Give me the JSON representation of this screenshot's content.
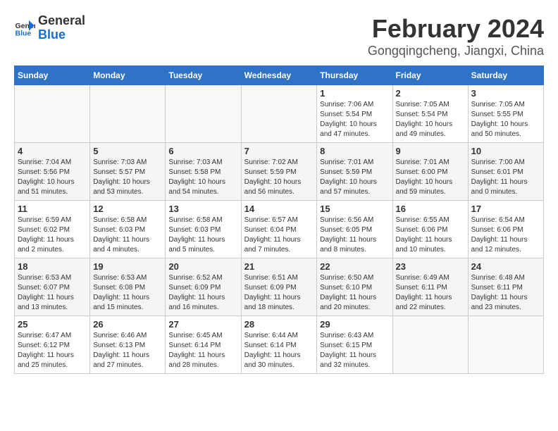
{
  "header": {
    "logo_general": "General",
    "logo_blue": "Blue",
    "title": "February 2024",
    "subtitle": "Gongqingcheng, Jiangxi, China"
  },
  "days_of_week": [
    "Sunday",
    "Monday",
    "Tuesday",
    "Wednesday",
    "Thursday",
    "Friday",
    "Saturday"
  ],
  "weeks": [
    [
      {
        "day": "",
        "info": ""
      },
      {
        "day": "",
        "info": ""
      },
      {
        "day": "",
        "info": ""
      },
      {
        "day": "",
        "info": ""
      },
      {
        "day": "1",
        "info": "Sunrise: 7:06 AM\nSunset: 5:54 PM\nDaylight: 10 hours and 47 minutes."
      },
      {
        "day": "2",
        "info": "Sunrise: 7:05 AM\nSunset: 5:54 PM\nDaylight: 10 hours and 49 minutes."
      },
      {
        "day": "3",
        "info": "Sunrise: 7:05 AM\nSunset: 5:55 PM\nDaylight: 10 hours and 50 minutes."
      }
    ],
    [
      {
        "day": "4",
        "info": "Sunrise: 7:04 AM\nSunset: 5:56 PM\nDaylight: 10 hours and 51 minutes."
      },
      {
        "day": "5",
        "info": "Sunrise: 7:03 AM\nSunset: 5:57 PM\nDaylight: 10 hours and 53 minutes."
      },
      {
        "day": "6",
        "info": "Sunrise: 7:03 AM\nSunset: 5:58 PM\nDaylight: 10 hours and 54 minutes."
      },
      {
        "day": "7",
        "info": "Sunrise: 7:02 AM\nSunset: 5:59 PM\nDaylight: 10 hours and 56 minutes."
      },
      {
        "day": "8",
        "info": "Sunrise: 7:01 AM\nSunset: 5:59 PM\nDaylight: 10 hours and 57 minutes."
      },
      {
        "day": "9",
        "info": "Sunrise: 7:01 AM\nSunset: 6:00 PM\nDaylight: 10 hours and 59 minutes."
      },
      {
        "day": "10",
        "info": "Sunrise: 7:00 AM\nSunset: 6:01 PM\nDaylight: 11 hours and 0 minutes."
      }
    ],
    [
      {
        "day": "11",
        "info": "Sunrise: 6:59 AM\nSunset: 6:02 PM\nDaylight: 11 hours and 2 minutes."
      },
      {
        "day": "12",
        "info": "Sunrise: 6:58 AM\nSunset: 6:03 PM\nDaylight: 11 hours and 4 minutes."
      },
      {
        "day": "13",
        "info": "Sunrise: 6:58 AM\nSunset: 6:03 PM\nDaylight: 11 hours and 5 minutes."
      },
      {
        "day": "14",
        "info": "Sunrise: 6:57 AM\nSunset: 6:04 PM\nDaylight: 11 hours and 7 minutes."
      },
      {
        "day": "15",
        "info": "Sunrise: 6:56 AM\nSunset: 6:05 PM\nDaylight: 11 hours and 8 minutes."
      },
      {
        "day": "16",
        "info": "Sunrise: 6:55 AM\nSunset: 6:06 PM\nDaylight: 11 hours and 10 minutes."
      },
      {
        "day": "17",
        "info": "Sunrise: 6:54 AM\nSunset: 6:06 PM\nDaylight: 11 hours and 12 minutes."
      }
    ],
    [
      {
        "day": "18",
        "info": "Sunrise: 6:53 AM\nSunset: 6:07 PM\nDaylight: 11 hours and 13 minutes."
      },
      {
        "day": "19",
        "info": "Sunrise: 6:53 AM\nSunset: 6:08 PM\nDaylight: 11 hours and 15 minutes."
      },
      {
        "day": "20",
        "info": "Sunrise: 6:52 AM\nSunset: 6:09 PM\nDaylight: 11 hours and 16 minutes."
      },
      {
        "day": "21",
        "info": "Sunrise: 6:51 AM\nSunset: 6:09 PM\nDaylight: 11 hours and 18 minutes."
      },
      {
        "day": "22",
        "info": "Sunrise: 6:50 AM\nSunset: 6:10 PM\nDaylight: 11 hours and 20 minutes."
      },
      {
        "day": "23",
        "info": "Sunrise: 6:49 AM\nSunset: 6:11 PM\nDaylight: 11 hours and 22 minutes."
      },
      {
        "day": "24",
        "info": "Sunrise: 6:48 AM\nSunset: 6:11 PM\nDaylight: 11 hours and 23 minutes."
      }
    ],
    [
      {
        "day": "25",
        "info": "Sunrise: 6:47 AM\nSunset: 6:12 PM\nDaylight: 11 hours and 25 minutes."
      },
      {
        "day": "26",
        "info": "Sunrise: 6:46 AM\nSunset: 6:13 PM\nDaylight: 11 hours and 27 minutes."
      },
      {
        "day": "27",
        "info": "Sunrise: 6:45 AM\nSunset: 6:14 PM\nDaylight: 11 hours and 28 minutes."
      },
      {
        "day": "28",
        "info": "Sunrise: 6:44 AM\nSunset: 6:14 PM\nDaylight: 11 hours and 30 minutes."
      },
      {
        "day": "29",
        "info": "Sunrise: 6:43 AM\nSunset: 6:15 PM\nDaylight: 11 hours and 32 minutes."
      },
      {
        "day": "",
        "info": ""
      },
      {
        "day": "",
        "info": ""
      }
    ]
  ]
}
